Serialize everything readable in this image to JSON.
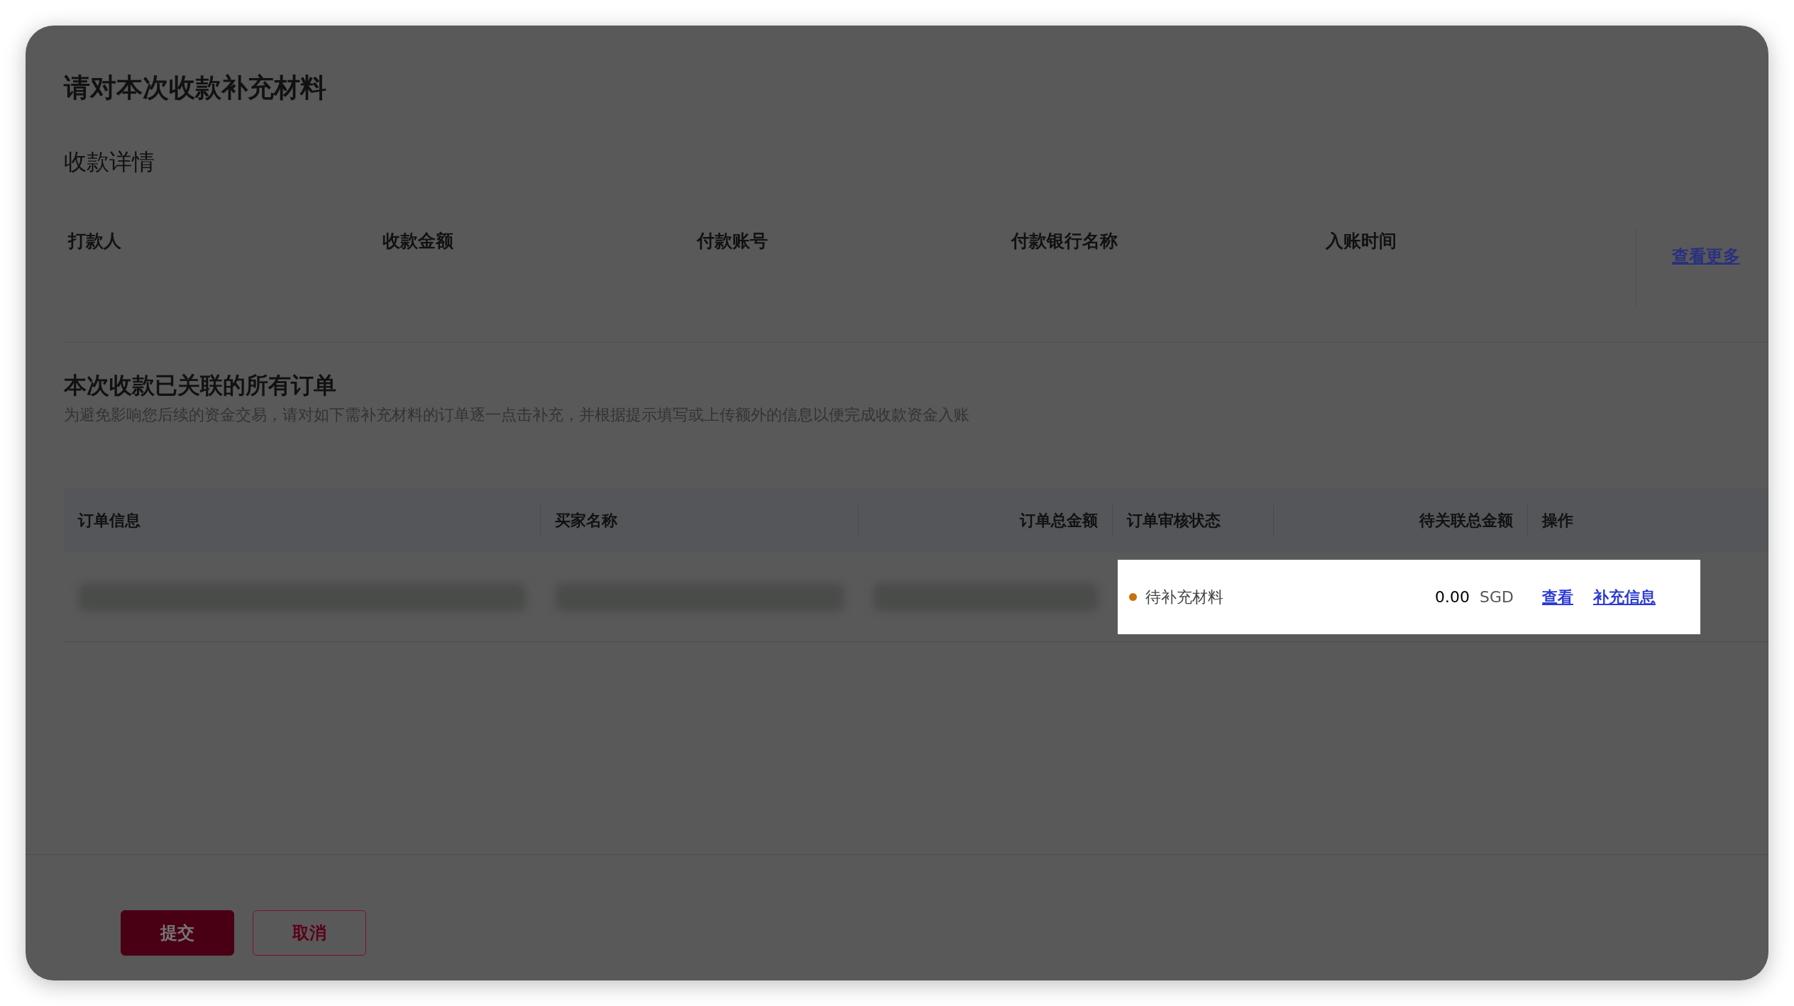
{
  "dialog": {
    "title": "请对本次收款补充材料"
  },
  "payment_details": {
    "title": "收款详情",
    "fields": [
      {
        "label": "打款人"
      },
      {
        "label": "收款金额"
      },
      {
        "label": "付款账号"
      },
      {
        "label": "付款银行名称"
      },
      {
        "label": "入账时间"
      }
    ],
    "see_more": "查看更多"
  },
  "orders": {
    "title": "本次收款已关联的所有订单",
    "description": "为避免影响您后续的资金交易，请对如下需补充材料的订单逐一点击补充，并根据提示填写或上传额外的信息以便完成收款资金入账",
    "columns": [
      "订单信息",
      "买家名称",
      "订单总金额",
      "订单审核状态",
      "待关联总金额",
      "操作"
    ],
    "rows": [
      {
        "highlighted": true,
        "status": {
          "label": "待补充材料",
          "color": "#c8700f"
        },
        "pending_amount": "0.00",
        "currency": "SGD",
        "actions": [
          "查看",
          "补充信息"
        ]
      }
    ]
  },
  "buttons": [
    {
      "kind": "primary",
      "label": "提交"
    },
    {
      "kind": "secondary",
      "label": "取消"
    }
  ]
}
